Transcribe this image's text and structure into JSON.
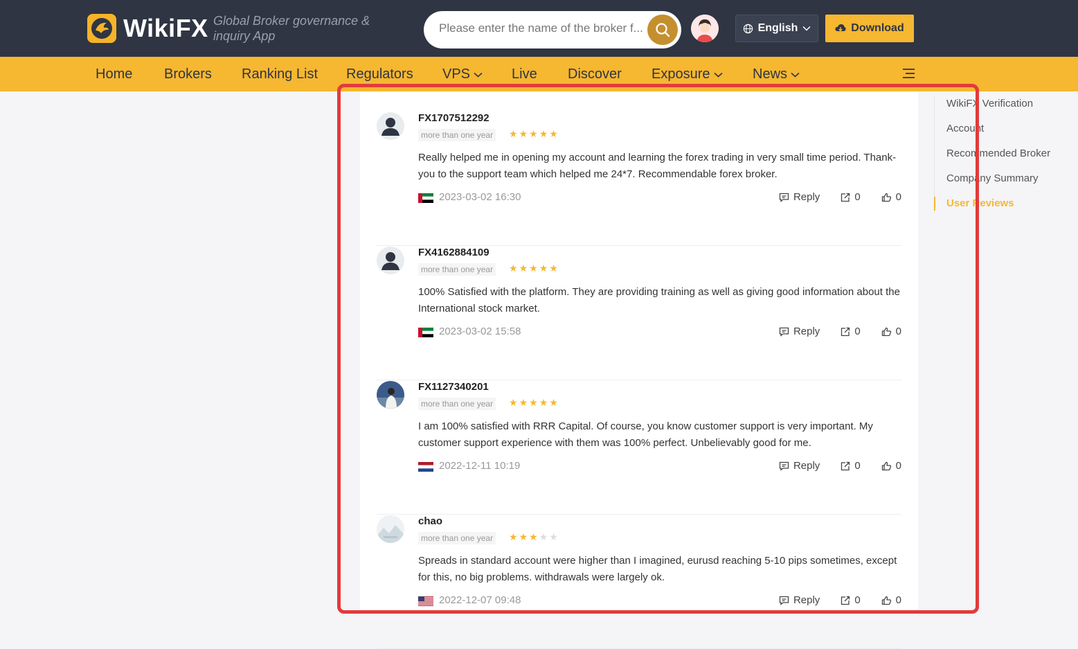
{
  "header": {
    "logo_text": "WikiFX",
    "slogan": "Global Broker governance & inquiry App",
    "search_placeholder": "Please enter the name of the broker f...",
    "language": "English",
    "download": "Download"
  },
  "nav": {
    "items": [
      {
        "label": "Home",
        "dropdown": false
      },
      {
        "label": "Brokers",
        "dropdown": false
      },
      {
        "label": "Ranking List",
        "dropdown": false
      },
      {
        "label": "Regulators",
        "dropdown": false
      },
      {
        "label": "VPS",
        "dropdown": true
      },
      {
        "label": "Live",
        "dropdown": false
      },
      {
        "label": "Discover",
        "dropdown": false
      },
      {
        "label": "Exposure",
        "dropdown": true
      },
      {
        "label": "News",
        "dropdown": true
      }
    ]
  },
  "reviews": [
    {
      "username": "FX1707512292",
      "time_label": "more than one year",
      "rating": 5,
      "text": "Really helped me in opening my account and learning the forex trading in very small time period. Thank-you to the support team which helped me 24*7. Recommendable forex broker.",
      "country_flag": "uae",
      "date": "2023-03-02 16:30",
      "reply_label": "Reply",
      "share_count": "0",
      "like_count": "0"
    },
    {
      "username": "FX4162884109",
      "time_label": "more than one year",
      "rating": 5,
      "text": "100% Satisfied with the platform. They are providing training as well as giving good information about the International stock market.",
      "country_flag": "uae",
      "date": "2023-03-02 15:58",
      "reply_label": "Reply",
      "share_count": "0",
      "like_count": "0"
    },
    {
      "username": "FX1127340201",
      "time_label": "more than one year",
      "rating": 5,
      "text": "I am 100% satisfied with RRR Capital. Of course, you know customer support is very important. My customer support experience with them was 100% perfect. Unbelievably good for me.",
      "country_flag": "netherlands",
      "date": "2022-12-11 10:19",
      "reply_label": "Reply",
      "share_count": "0",
      "like_count": "0"
    },
    {
      "username": "chao",
      "time_label": "more than one year",
      "rating": 3,
      "text": "Spreads in standard account were higher than I imagined, eurusd reaching 5-10 pips sometimes, except for this, no big problems. withdrawals were largely ok.",
      "country_flag": "usa",
      "date": "2022-12-07 09:48",
      "reply_label": "Reply",
      "share_count": "0",
      "like_count": "0"
    }
  ],
  "sidebar": {
    "items": [
      {
        "label": "WikiFX Verification",
        "active": false
      },
      {
        "label": "Account",
        "active": false
      },
      {
        "label": "Recommended Broker",
        "active": false
      },
      {
        "label": "Company Summary",
        "active": false
      },
      {
        "label": "User Reviews",
        "active": true
      }
    ]
  },
  "colors": {
    "header_bg": "#2f3542",
    "accent": "#f6b731",
    "star_on": "#f6b731",
    "star_off": "#dddddd",
    "highlight": "#e23b3b"
  }
}
